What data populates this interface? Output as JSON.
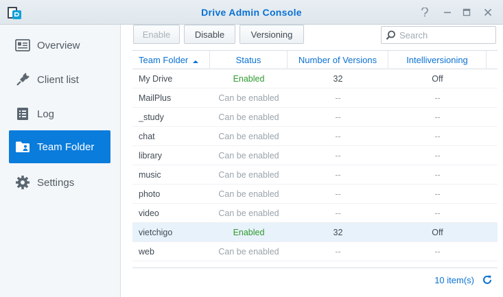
{
  "window": {
    "title": "Drive Admin Console",
    "icons": {
      "app": "drive-app-icon",
      "help": "help-icon",
      "minimize": "minimize-icon",
      "maximize": "maximize-icon",
      "close": "close-icon"
    }
  },
  "sidebar": {
    "items": [
      {
        "label": "Overview",
        "icon": "overview-icon",
        "active": false
      },
      {
        "label": "Client list",
        "icon": "plug-icon",
        "active": false
      },
      {
        "label": "Log",
        "icon": "log-icon",
        "active": false
      },
      {
        "label": "Team Folder",
        "icon": "team-folder-icon",
        "active": true
      },
      {
        "label": "Settings",
        "icon": "gear-icon",
        "active": false
      }
    ]
  },
  "toolbar": {
    "enable_label": "Enable",
    "disable_label": "Disable",
    "versioning_label": "Versioning",
    "search_placeholder": "Search",
    "search_value": ""
  },
  "table": {
    "columns": [
      "Team Folder",
      "Status",
      "Number of Versions",
      "Intelliversioning"
    ],
    "sort_column": "Team Folder",
    "sort_direction": "ascending",
    "rows": [
      {
        "name": "My Drive",
        "status": "Enabled",
        "versions": "32",
        "intelli": "Off",
        "selected": false
      },
      {
        "name": "MailPlus",
        "status": "Can be enabled",
        "versions": "--",
        "intelli": "--",
        "selected": false
      },
      {
        "name": "_study",
        "status": "Can be enabled",
        "versions": "--",
        "intelli": "--",
        "selected": false
      },
      {
        "name": "chat",
        "status": "Can be enabled",
        "versions": "--",
        "intelli": "--",
        "selected": false
      },
      {
        "name": "library",
        "status": "Can be enabled",
        "versions": "--",
        "intelli": "--",
        "selected": false
      },
      {
        "name": "music",
        "status": "Can be enabled",
        "versions": "--",
        "intelli": "--",
        "selected": false
      },
      {
        "name": "photo",
        "status": "Can be enabled",
        "versions": "--",
        "intelli": "--",
        "selected": false
      },
      {
        "name": "video",
        "status": "Can be enabled",
        "versions": "--",
        "intelli": "--",
        "selected": false
      },
      {
        "name": "vietchigo",
        "status": "Enabled",
        "versions": "32",
        "intelli": "Off",
        "selected": true
      },
      {
        "name": "web",
        "status": "Can be enabled",
        "versions": "--",
        "intelli": "--",
        "selected": false
      }
    ]
  },
  "footer": {
    "count": "10 item(s)"
  },
  "colors": {
    "accent": "#0a7cdb",
    "enabled": "#2e9a2e",
    "muted": "#9aa4ac",
    "selected_row": "#e8f2fb"
  }
}
